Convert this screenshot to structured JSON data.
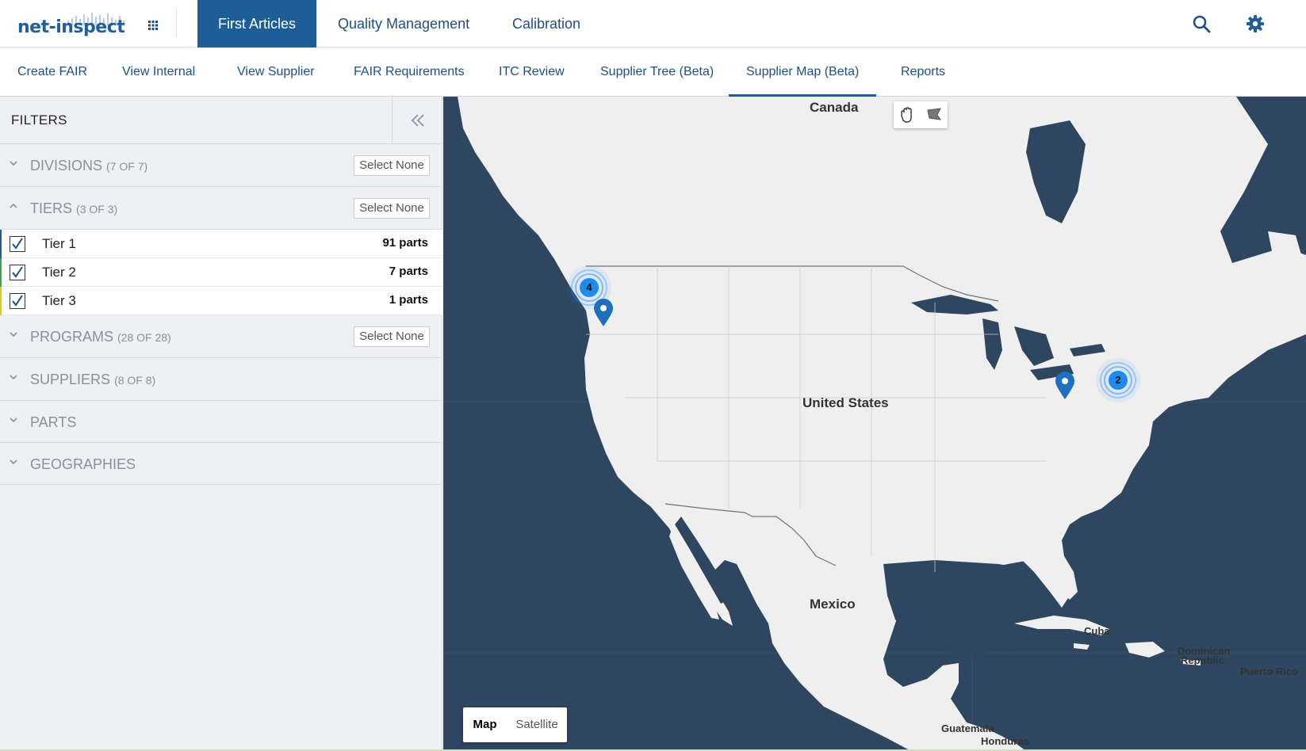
{
  "brand": {
    "logo_text": "net-inspect",
    "primary_color": "#1f5d99",
    "map_water_color": "#2e4660",
    "map_land_color": "#efefef"
  },
  "header": {
    "main_tabs": [
      {
        "label": "First Articles",
        "active": true
      },
      {
        "label": "Quality Management",
        "active": false
      },
      {
        "label": "Calibration",
        "active": false
      }
    ],
    "icons": [
      "apps-grid-icon",
      "search-icon",
      "gear-icon"
    ]
  },
  "subnav": {
    "tabs": [
      {
        "label": "Create FAIR",
        "active": false
      },
      {
        "label": "View Internal",
        "active": false
      },
      {
        "label": "View Supplier",
        "active": false
      },
      {
        "label": "FAIR Requirements",
        "active": false
      },
      {
        "label": "ITC Review",
        "active": false
      },
      {
        "label": "Supplier Tree (Beta)",
        "active": false
      },
      {
        "label": "Supplier Map (Beta)",
        "active": true
      },
      {
        "label": "Reports",
        "active": false
      }
    ]
  },
  "filters": {
    "title": "FILTERS",
    "select_none_label": "Select None",
    "sections": [
      {
        "title": "DIVISIONS",
        "count": "(7 OF 7)",
        "expanded": false,
        "has_select_none": true
      },
      {
        "title": "TIERS",
        "count": "(3 OF 3)",
        "expanded": true,
        "has_select_none": true
      },
      {
        "title": "PROGRAMS",
        "count": "(28 OF 28)",
        "expanded": false,
        "has_select_none": true
      },
      {
        "title": "SUPPLIERS",
        "count": "(8 OF 8)",
        "expanded": false,
        "has_select_none": false
      },
      {
        "title": "PARTS",
        "count": "",
        "expanded": false,
        "has_select_none": false
      },
      {
        "title": "GEOGRAPHIES",
        "count": "",
        "expanded": false,
        "has_select_none": false
      }
    ],
    "tiers": [
      {
        "name": "Tier 1",
        "parts": "91 parts",
        "checked": true,
        "accent": "#1f5d99"
      },
      {
        "name": "Tier 2",
        "parts": "7 parts",
        "checked": true,
        "accent": "#3fa34d"
      },
      {
        "name": "Tier 3",
        "parts": "1 parts",
        "checked": true,
        "accent": "#e6c229"
      }
    ]
  },
  "map": {
    "labels": {
      "canada": "Canada",
      "united_states": "United States",
      "mexico": "Mexico",
      "cuba": "Cuba",
      "dominican_republic_1": "Dominican",
      "dominican_republic_2": "Republic",
      "puerto_rico": "Puerto Rico",
      "guatemala": "Guatemala",
      "honduras": "Honduras"
    },
    "clusters": [
      {
        "count": "4",
        "region": "pacific-northwest"
      },
      {
        "count": "2",
        "region": "northeast"
      }
    ],
    "pins": [
      "pacific-northwest-pin",
      "great-lakes-pin"
    ],
    "map_type": {
      "map_label": "Map",
      "satellite_label": "Satellite",
      "selected": "Map"
    },
    "tools": [
      "pan-hand-icon",
      "draw-shape-icon"
    ]
  }
}
